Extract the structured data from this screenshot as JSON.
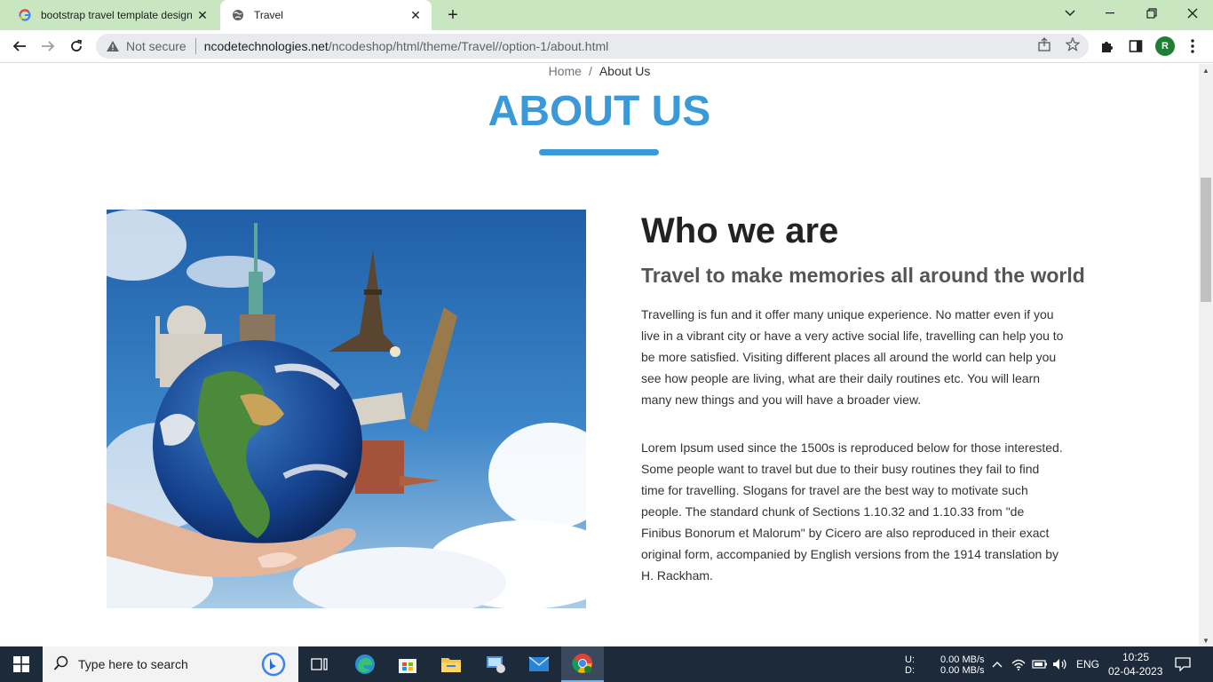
{
  "browser": {
    "tabs": [
      {
        "title": "bootstrap travel template design",
        "active": false,
        "favicon": "google-g-icon"
      },
      {
        "title": "Travel",
        "active": true,
        "favicon": "globe-icon"
      }
    ],
    "address": {
      "security_label": "Not secure",
      "host": "ncodetechnologies.net",
      "path": "/ncodeshop/html/theme/Travel//option-1/about.html"
    },
    "profile_initial": "R"
  },
  "page": {
    "breadcrumb": {
      "home": "Home",
      "divider": "/",
      "current": "About Us"
    },
    "title": "ABOUT US",
    "heading": "Who we are",
    "subheading": "Travel to make memories all around the world",
    "paragraph1": "Travelling is fun and it offer many unique experience. No matter even if you live in a vibrant city or have a very active social life, travelling can help you to be more satisfied. Visiting different places all around the world can help you see how people are living, what are their daily routines etc. You will learn many new things and you will have a broader view.",
    "paragraph2": "Lorem Ipsum used since the 1500s is reproduced below for those interested. Some people want to travel but due to their busy routines they fail to find time for travelling. Slogans for travel are the best way to motivate such people. The standard chunk of Sections 1.10.32 and 1.10.33 from \"de Finibus Bonorum et Malorum\" by Cicero are also reproduced in their exact original form, accompanied by English versions from the 1914 translation by H. Rackham.",
    "accent_color": "#3a9ad9"
  },
  "taskbar": {
    "search_placeholder": "Type here to search",
    "net_upload_label": "U:",
    "net_download_label": "D:",
    "net_upload": "0.00 MB/s",
    "net_download": "0.00 MB/s",
    "language": "ENG",
    "time": "10:25",
    "date": "02-04-2023"
  }
}
